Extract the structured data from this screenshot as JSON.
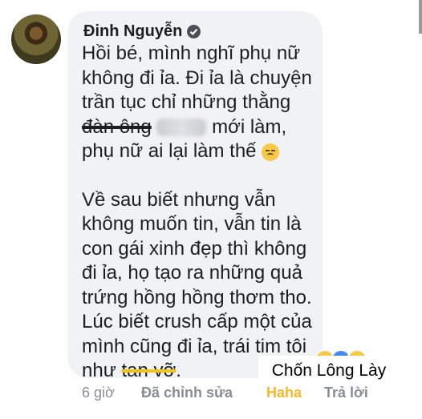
{
  "comment": {
    "author": "Đinh Nguyễn",
    "lines_p1": [
      "Hồi bé, mình nghĩ phụ nữ",
      "không đi ỉa. Đi ỉa là chuyện",
      "trần tục chỉ những thằng"
    ],
    "line4_strike": "đàn ông",
    "line4_tail": " mới làm,",
    "line5": "phụ nữ ai lại làm thế",
    "lines_p2": [
      "Về sau biết nhưng vẫn",
      "không muốn tin, vẫn tin là",
      "con gái xinh đẹp thì không",
      "đi ỉa, họ tạo ra những quả",
      "trứng hồng hồng thơm tho.",
      "Lúc biết crush cấp một của",
      "mình cũng đi ỉa, trái tim tôi"
    ],
    "last_prefix": "như ",
    "last_strike": "tan vỡ",
    "last_suffix": "."
  },
  "meta": {
    "time": "6 giờ",
    "edited": "Đã chỉnh sửa",
    "reaction": "Haha",
    "reply": "Trả lời"
  },
  "watermark": "Chốn Lông Lày",
  "colors": {
    "bubble": "#f0f2f5",
    "haha": "#f5b928",
    "meta": "#8a8d91"
  }
}
